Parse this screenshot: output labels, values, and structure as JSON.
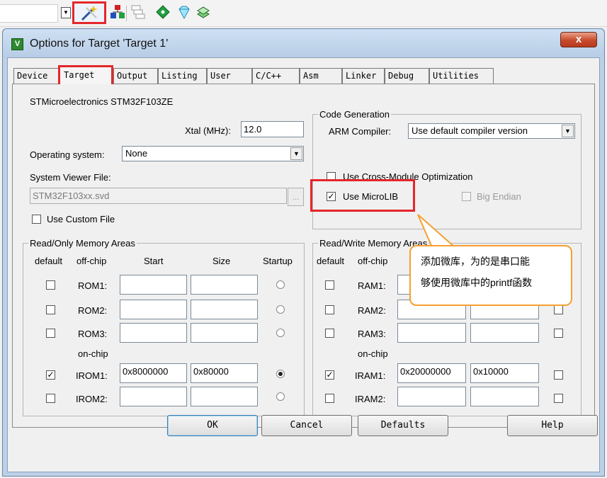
{
  "dialog": {
    "title": "Options for Target 'Target 1'",
    "close_label": "x",
    "app_icon_label": "V"
  },
  "tabs": [
    {
      "label": "Device"
    },
    {
      "label": "Target"
    },
    {
      "label": "Output"
    },
    {
      "label": "Listing"
    },
    {
      "label": "User"
    },
    {
      "label": "C/C++"
    },
    {
      "label": "Asm"
    },
    {
      "label": "Linker"
    },
    {
      "label": "Debug"
    },
    {
      "label": "Utilities"
    }
  ],
  "target": {
    "device_name": "STMicroelectronics STM32F103ZE",
    "xtal_label": "Xtal (MHz):",
    "xtal_value": "12.0",
    "os_label": "Operating system:",
    "os_value": "None",
    "svd_label": "System Viewer File:",
    "svd_value": "STM32F103xx.svd",
    "browse_label": "...",
    "custom_file_label": "Use Custom File"
  },
  "code_gen": {
    "legend": "Code Generation",
    "compiler_label": "ARM Compiler:",
    "compiler_value": "Use default compiler version",
    "cross_module_label": "Use Cross-Module Optimization",
    "microlib_label": "Use MicroLIB",
    "big_endian_label": "Big Endian"
  },
  "callout": {
    "line1": "添加微库，为的是串口能",
    "line2": "够使用微库中的printf函数"
  },
  "ro_memory": {
    "legend": "Read/Only Memory Areas",
    "headers": {
      "default": "default",
      "offchip": "off-chip",
      "start": "Start",
      "size": "Size",
      "startup": "Startup"
    },
    "offchip_rows": [
      {
        "name": "ROM1:",
        "start": "",
        "size": ""
      },
      {
        "name": "ROM2:",
        "start": "",
        "size": ""
      },
      {
        "name": "ROM3:",
        "start": "",
        "size": ""
      }
    ],
    "onchip_label": "on-chip",
    "onchip_rows": [
      {
        "name": "IROM1:",
        "start": "0x8000000",
        "size": "0x80000"
      },
      {
        "name": "IROM2:",
        "start": "",
        "size": ""
      }
    ]
  },
  "rw_memory": {
    "legend": "Read/Write Memory Areas",
    "headers": {
      "default": "default",
      "offchip": "off-chip"
    },
    "offchip_rows": [
      {
        "name": "RAM1:",
        "start": "",
        "size": ""
      },
      {
        "name": "RAM2:",
        "start": "",
        "size": ""
      },
      {
        "name": "RAM3:",
        "start": "",
        "size": ""
      }
    ],
    "onchip_label": "on-chip",
    "onchip_rows": [
      {
        "name": "IRAM1:",
        "start": "0x20000000",
        "size": "0x10000"
      },
      {
        "name": "IRAM2:",
        "start": "",
        "size": ""
      }
    ]
  },
  "buttons": {
    "ok": "OK",
    "cancel": "Cancel",
    "defaults": "Defaults",
    "help": "Help"
  },
  "checkmark": "✓",
  "colors": {
    "highlight": "#e5262a",
    "callout_border": "#f5a030"
  }
}
